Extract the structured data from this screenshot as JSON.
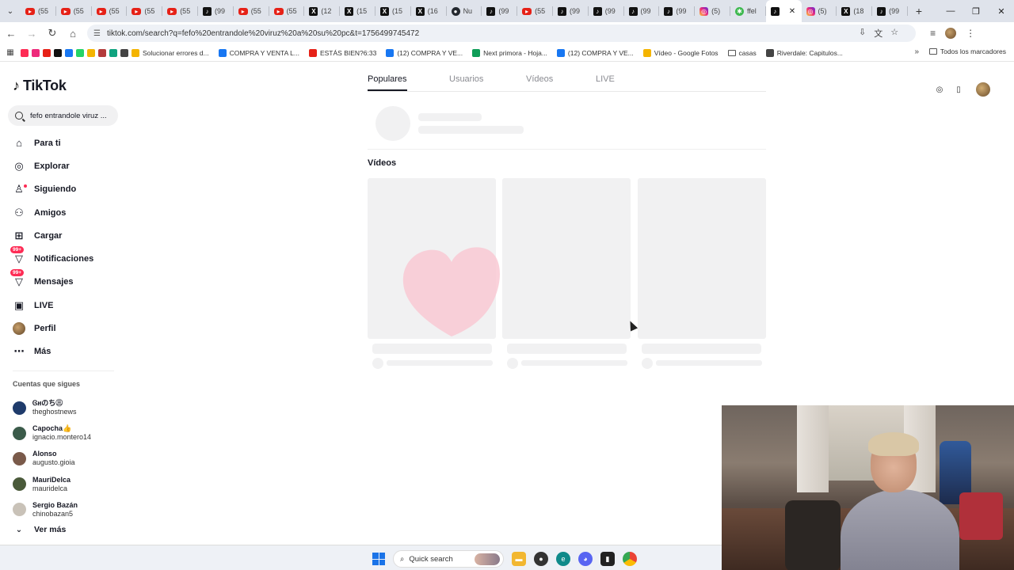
{
  "browser": {
    "tabs": [
      {
        "icon": "youtube-icon",
        "title": "(55"
      },
      {
        "icon": "youtube-icon",
        "title": "(55"
      },
      {
        "icon": "youtube-icon",
        "title": "(55"
      },
      {
        "icon": "youtube-icon",
        "title": "(55"
      },
      {
        "icon": "youtube-icon",
        "title": "(55"
      },
      {
        "icon": "tiktok-icon",
        "title": "(99"
      },
      {
        "icon": "youtube-icon",
        "title": "(55"
      },
      {
        "icon": "youtube-icon",
        "title": "(55"
      },
      {
        "icon": "x-icon",
        "title": "(12"
      },
      {
        "icon": "x-icon",
        "title": "(15"
      },
      {
        "icon": "x-icon",
        "title": "(15"
      },
      {
        "icon": "x-icon",
        "title": "(16"
      },
      {
        "icon": "github-icon",
        "title": "Nu"
      },
      {
        "icon": "tiktok-icon",
        "title": "(99"
      },
      {
        "icon": "youtube-icon",
        "title": "(55"
      },
      {
        "icon": "tiktok-icon",
        "title": "(99"
      },
      {
        "icon": "tiktok-icon",
        "title": "(99"
      },
      {
        "icon": "tiktok-icon",
        "title": "(99"
      },
      {
        "icon": "tiktok-icon",
        "title": "(99"
      },
      {
        "icon": "instagram-icon",
        "title": "(5)"
      },
      {
        "icon": "green-icon",
        "title": "ffel"
      },
      {
        "icon": "tiktok-icon",
        "title": "",
        "active": true
      },
      {
        "icon": "instagram-icon",
        "title": "(5)"
      },
      {
        "icon": "x-icon",
        "title": "(18"
      },
      {
        "icon": "tiktok-icon",
        "title": "(99"
      }
    ],
    "url": "tiktok.com/search?q=fefo%20entrandole%20viruz%20a%20su%20pc&t=1756499745472",
    "bookmarks": [
      {
        "label": "",
        "color": "#fe2c55"
      },
      {
        "label": "",
        "color": "#ee2a7b"
      },
      {
        "label": "",
        "color": "#e62117"
      },
      {
        "label": "",
        "color": "#111111"
      },
      {
        "label": "",
        "color": "#1877f2"
      },
      {
        "label": "",
        "color": "#25d366"
      },
      {
        "label": "",
        "color": "#f4b400"
      },
      {
        "label": "",
        "color": "#b33b3b"
      },
      {
        "label": "",
        "color": "#10a37f"
      },
      {
        "label": "",
        "color": "#444444"
      },
      {
        "label": "Solucionar errores d...",
        "color": "#f4b400"
      },
      {
        "label": "COMPRA Y VENTA L...",
        "color": "#1877f2"
      },
      {
        "label": "ESTÁS BIEN?6:33",
        "color": "#e62117"
      },
      {
        "label": "(12) COMPRA Y VE...",
        "color": "#1877f2"
      },
      {
        "label": "Next primora - Hoja...",
        "color": "#0f9d58"
      },
      {
        "label": "(12) COMPRA Y VE...",
        "color": "#1877f2"
      },
      {
        "label": "Vídeo - Google Fotos",
        "color": "#f4b400"
      },
      {
        "label": "casas",
        "color": "folder"
      },
      {
        "label": "Riverdale: Capitulos...",
        "color": "#444444"
      }
    ],
    "all_bookmarks": "Todos los marcadores"
  },
  "tiktok": {
    "logo": "TikTok",
    "search_value": "fefo entrandole viruz ...",
    "nav": [
      {
        "icon": "home-icon",
        "label": "Para ti"
      },
      {
        "icon": "compass-icon",
        "label": "Explorar"
      },
      {
        "icon": "following-icon",
        "label": "Siguiendo"
      },
      {
        "icon": "friends-icon",
        "label": "Amigos"
      },
      {
        "icon": "upload-icon",
        "label": "Cargar"
      },
      {
        "icon": "inbox-icon",
        "label": "Notificaciones",
        "badge": "99+"
      },
      {
        "icon": "messages-icon",
        "label": "Mensajes",
        "badge": "99+"
      },
      {
        "icon": "live-icon",
        "label": "LIVE"
      },
      {
        "icon": "avatar",
        "label": "Perfil"
      },
      {
        "icon": "more-icon",
        "label": "Más"
      }
    ],
    "following_header": "Cuentas que sigues",
    "following": [
      {
        "name": "Ꮆዘのち㊂",
        "user": "theghostnews",
        "color": "#1f3b6b"
      },
      {
        "name": "Capocha👍",
        "user": "ignacio.montero14",
        "color": "#3b5b4a"
      },
      {
        "name": "Alonso",
        "user": "augusto.gioia",
        "color": "#7a5a4a"
      },
      {
        "name": "MauriDelca",
        "user": "mauridelca",
        "color": "#4a5a3a"
      },
      {
        "name": "Sergio Bazán",
        "user": "chinobazan5",
        "color": "#c9c2b8"
      }
    ],
    "ver_mas": "Ver más",
    "search_tabs": [
      "Populares",
      "Usuarios",
      "Vídeos",
      "LIVE"
    ],
    "videos_heading": "Vídeos"
  },
  "taskbar": {
    "search_label": "Quick search"
  }
}
